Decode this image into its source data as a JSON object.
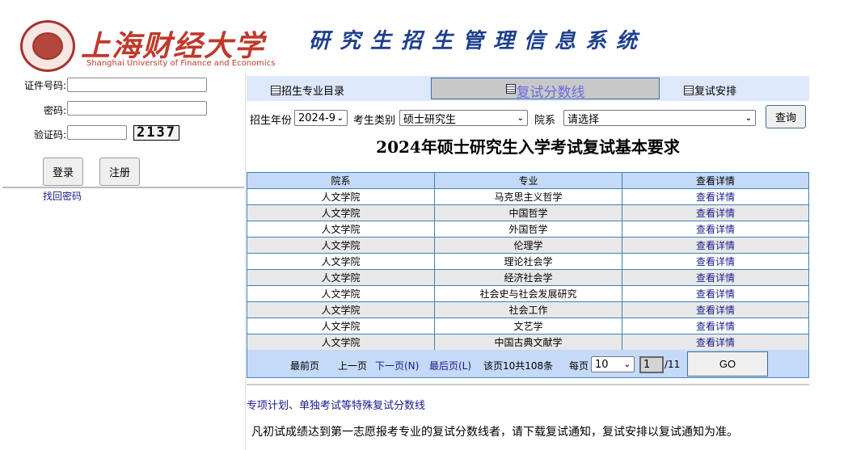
{
  "header": {
    "university_cn": "上海财经大学",
    "university_en": "Shanghai University of Finance and Economics",
    "system_title": "研究生招生管理信息系统"
  },
  "login": {
    "id_label": "证件号码:",
    "password_label": "密码:",
    "captcha_label": "验证码:",
    "captcha_code": "2137",
    "login_button": "登录",
    "register_button": "注册",
    "forgot_link": "找回密码"
  },
  "tabs": [
    {
      "label": "招生专业目录",
      "active": false
    },
    {
      "label": "复试分数线",
      "active": true
    },
    {
      "label": "复试安排",
      "active": false
    }
  ],
  "filters": {
    "year_label": "招生年份",
    "year_value": "2024-9",
    "type_label": "考生类别",
    "type_value": "硕士研究生",
    "dept_label": "院系",
    "dept_value": "请选择",
    "query_button": "查询"
  },
  "heading": "2024年硕士研究生入学考试复试基本要求",
  "table": {
    "headers": [
      "院系",
      "专业",
      "查看详情"
    ],
    "rows": [
      [
        "人文学院",
        "马克思主义哲学",
        "查看详情"
      ],
      [
        "人文学院",
        "中国哲学",
        "查看详情"
      ],
      [
        "人文学院",
        "外国哲学",
        "查看详情"
      ],
      [
        "人文学院",
        "伦理学",
        "查看详情"
      ],
      [
        "人文学院",
        "理论社会学",
        "查看详情"
      ],
      [
        "人文学院",
        "经济社会学",
        "查看详情"
      ],
      [
        "人文学院",
        "社会史与社会发展研究",
        "查看详情"
      ],
      [
        "人文学院",
        "社会工作",
        "查看详情"
      ],
      [
        "人文学院",
        "文艺学",
        "查看详情"
      ],
      [
        "人文学院",
        "中国古典文献学",
        "查看详情"
      ]
    ]
  },
  "pager": {
    "first": "最前页",
    "prev": "上一页",
    "next": "下一页(N)",
    "last": "最后页(L)",
    "summary": "该页10共108条",
    "per_page_label": "每页",
    "per_page_value": "10",
    "page_value": "1",
    "total_pages": "/11",
    "go_button": "GO"
  },
  "special_link": "专项计划、单独考试等特殊复试分数线",
  "notice": "凡初试成绩达到第一志愿报考专业的复试分数线者，请下载复试通知，复试安排以复试通知为准。",
  "colors": {
    "brand_red": "#c0392b",
    "title_blue": "#1c3f8e",
    "table_header": "#c5d9f8",
    "link": "#1a1a8c"
  }
}
